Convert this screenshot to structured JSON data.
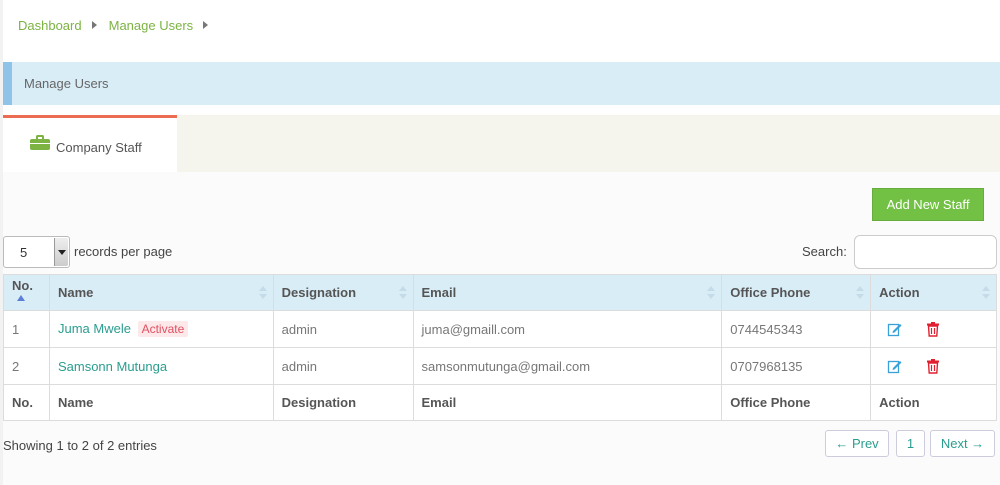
{
  "breadcrumb": {
    "items": [
      "Dashboard",
      "Manage Users"
    ]
  },
  "panel": {
    "title": "Manage Users"
  },
  "tab": {
    "label": "Company Staff",
    "icon": "briefcase-icon"
  },
  "toolbar": {
    "add_label": "Add New Staff"
  },
  "length": {
    "value": "5",
    "label": "records per page"
  },
  "search": {
    "label": "Search:",
    "value": ""
  },
  "table": {
    "columns": [
      "No.",
      "Name",
      "Designation",
      "Email",
      "Office Phone",
      "Action"
    ],
    "rows": [
      {
        "no": "1",
        "name": "Juma Mwele",
        "badge": "Activate",
        "designation": "admin",
        "email": "juma@gmaill.com",
        "phone": "0744545343"
      },
      {
        "no": "2",
        "name": "Samsonn Mutunga",
        "designation": "admin",
        "email": "samsonmutunga@gmail.com",
        "phone": "0707968135"
      }
    ],
    "footer": [
      "No.",
      "Name",
      "Designation",
      "Email",
      "Office Phone",
      "Action"
    ]
  },
  "info": "Showing 1 to 2 of 2 entries",
  "pagination": {
    "prev": "← Prev",
    "page": "1",
    "next": "Next →"
  },
  "colors": {
    "accent_green": "#72c044",
    "link": "#2a9d8f",
    "header_bg": "#d9edf7",
    "tab_border": "#ec6b53",
    "danger": "#e02030",
    "edit": "#3aa0d8"
  }
}
